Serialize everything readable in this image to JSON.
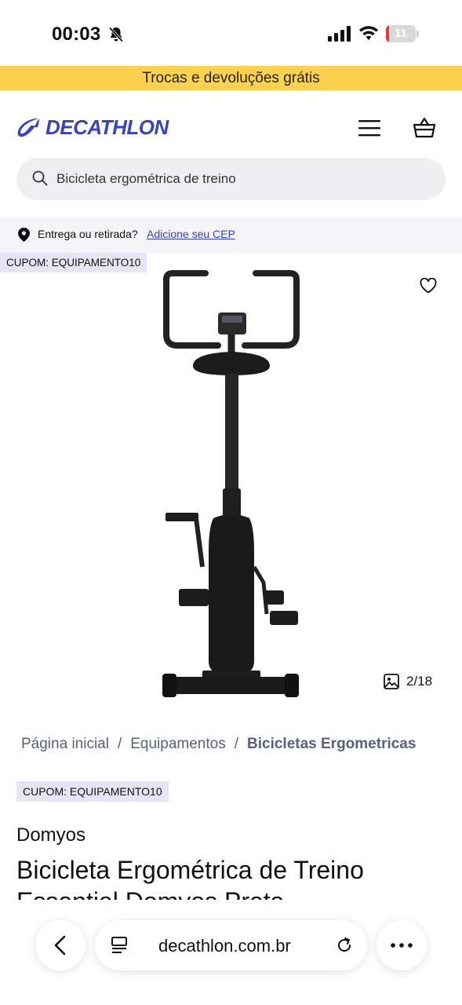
{
  "status_bar": {
    "time": "00:03",
    "battery_level": "11",
    "battery_fraction": 0.11,
    "icons": [
      "bell-slash-icon",
      "signal-icon",
      "wifi-icon",
      "battery-icon"
    ]
  },
  "promo_banner": {
    "text": "Trocas e devoluções grátis",
    "color": "#fcd14d"
  },
  "header": {
    "logo_text": "DECATHLON",
    "brand_color": "#3643ba",
    "icons": [
      "menu-icon",
      "basket-icon"
    ]
  },
  "search": {
    "value": "Bicicleta ergométrica de treino"
  },
  "delivery": {
    "label": "Entrega ou retirada?",
    "link": "Adicione seu CEP"
  },
  "gallery": {
    "coupon": "CUPOM: EQUIPAMENTO10",
    "counter": "2/18"
  },
  "breadcrumb": {
    "items": [
      "Página inicial",
      "Equipamentos",
      "Bicicletas Ergometricas"
    ],
    "separator": "/"
  },
  "product": {
    "coupon": "CUPOM: EQUIPAMENTO10",
    "brand": "Domyos",
    "title": "Bicicleta Ergométrica de Treino Essential Domyos Preta"
  },
  "browser": {
    "url": "decathlon.com.br",
    "icons": [
      "back-icon",
      "reader-icon",
      "reload-icon",
      "more-icon"
    ]
  }
}
